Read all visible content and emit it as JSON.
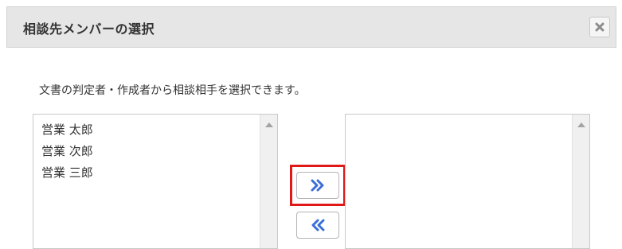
{
  "dialog": {
    "title": "相談先メンバーの選択",
    "close_icon": "close-icon"
  },
  "description": "文書の判定者・作成者から相談相手を選択できます。",
  "available_list": {
    "items": [
      "営業 太郎",
      "営業 次郎",
      "営業 三郎"
    ]
  },
  "selected_list": {
    "items": []
  },
  "buttons": {
    "add_icon": "double-chevron-right-icon",
    "remove_icon": "double-chevron-left-icon"
  },
  "colors": {
    "accent": "#3b6fd8",
    "highlight": "#e01818"
  }
}
